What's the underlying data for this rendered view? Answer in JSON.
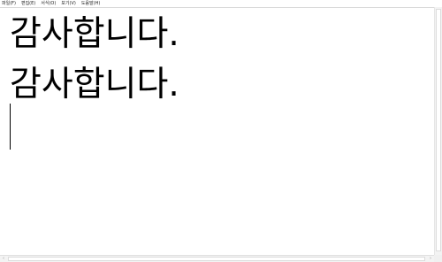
{
  "menu": {
    "items": [
      "파일(F)",
      "편집(E)",
      "서식(O)",
      "보기(V)",
      "도움말(H)"
    ]
  },
  "editor": {
    "lines": [
      "감사합니다.",
      "감사합니다."
    ]
  },
  "scrollbar": {
    "left_arrow_icon": "chevron-left-icon",
    "right_arrow_icon": "chevron-right-icon"
  },
  "colors": {
    "background": "#ffffff",
    "text": "#000000",
    "scroll_track": "#f3f3f3"
  }
}
